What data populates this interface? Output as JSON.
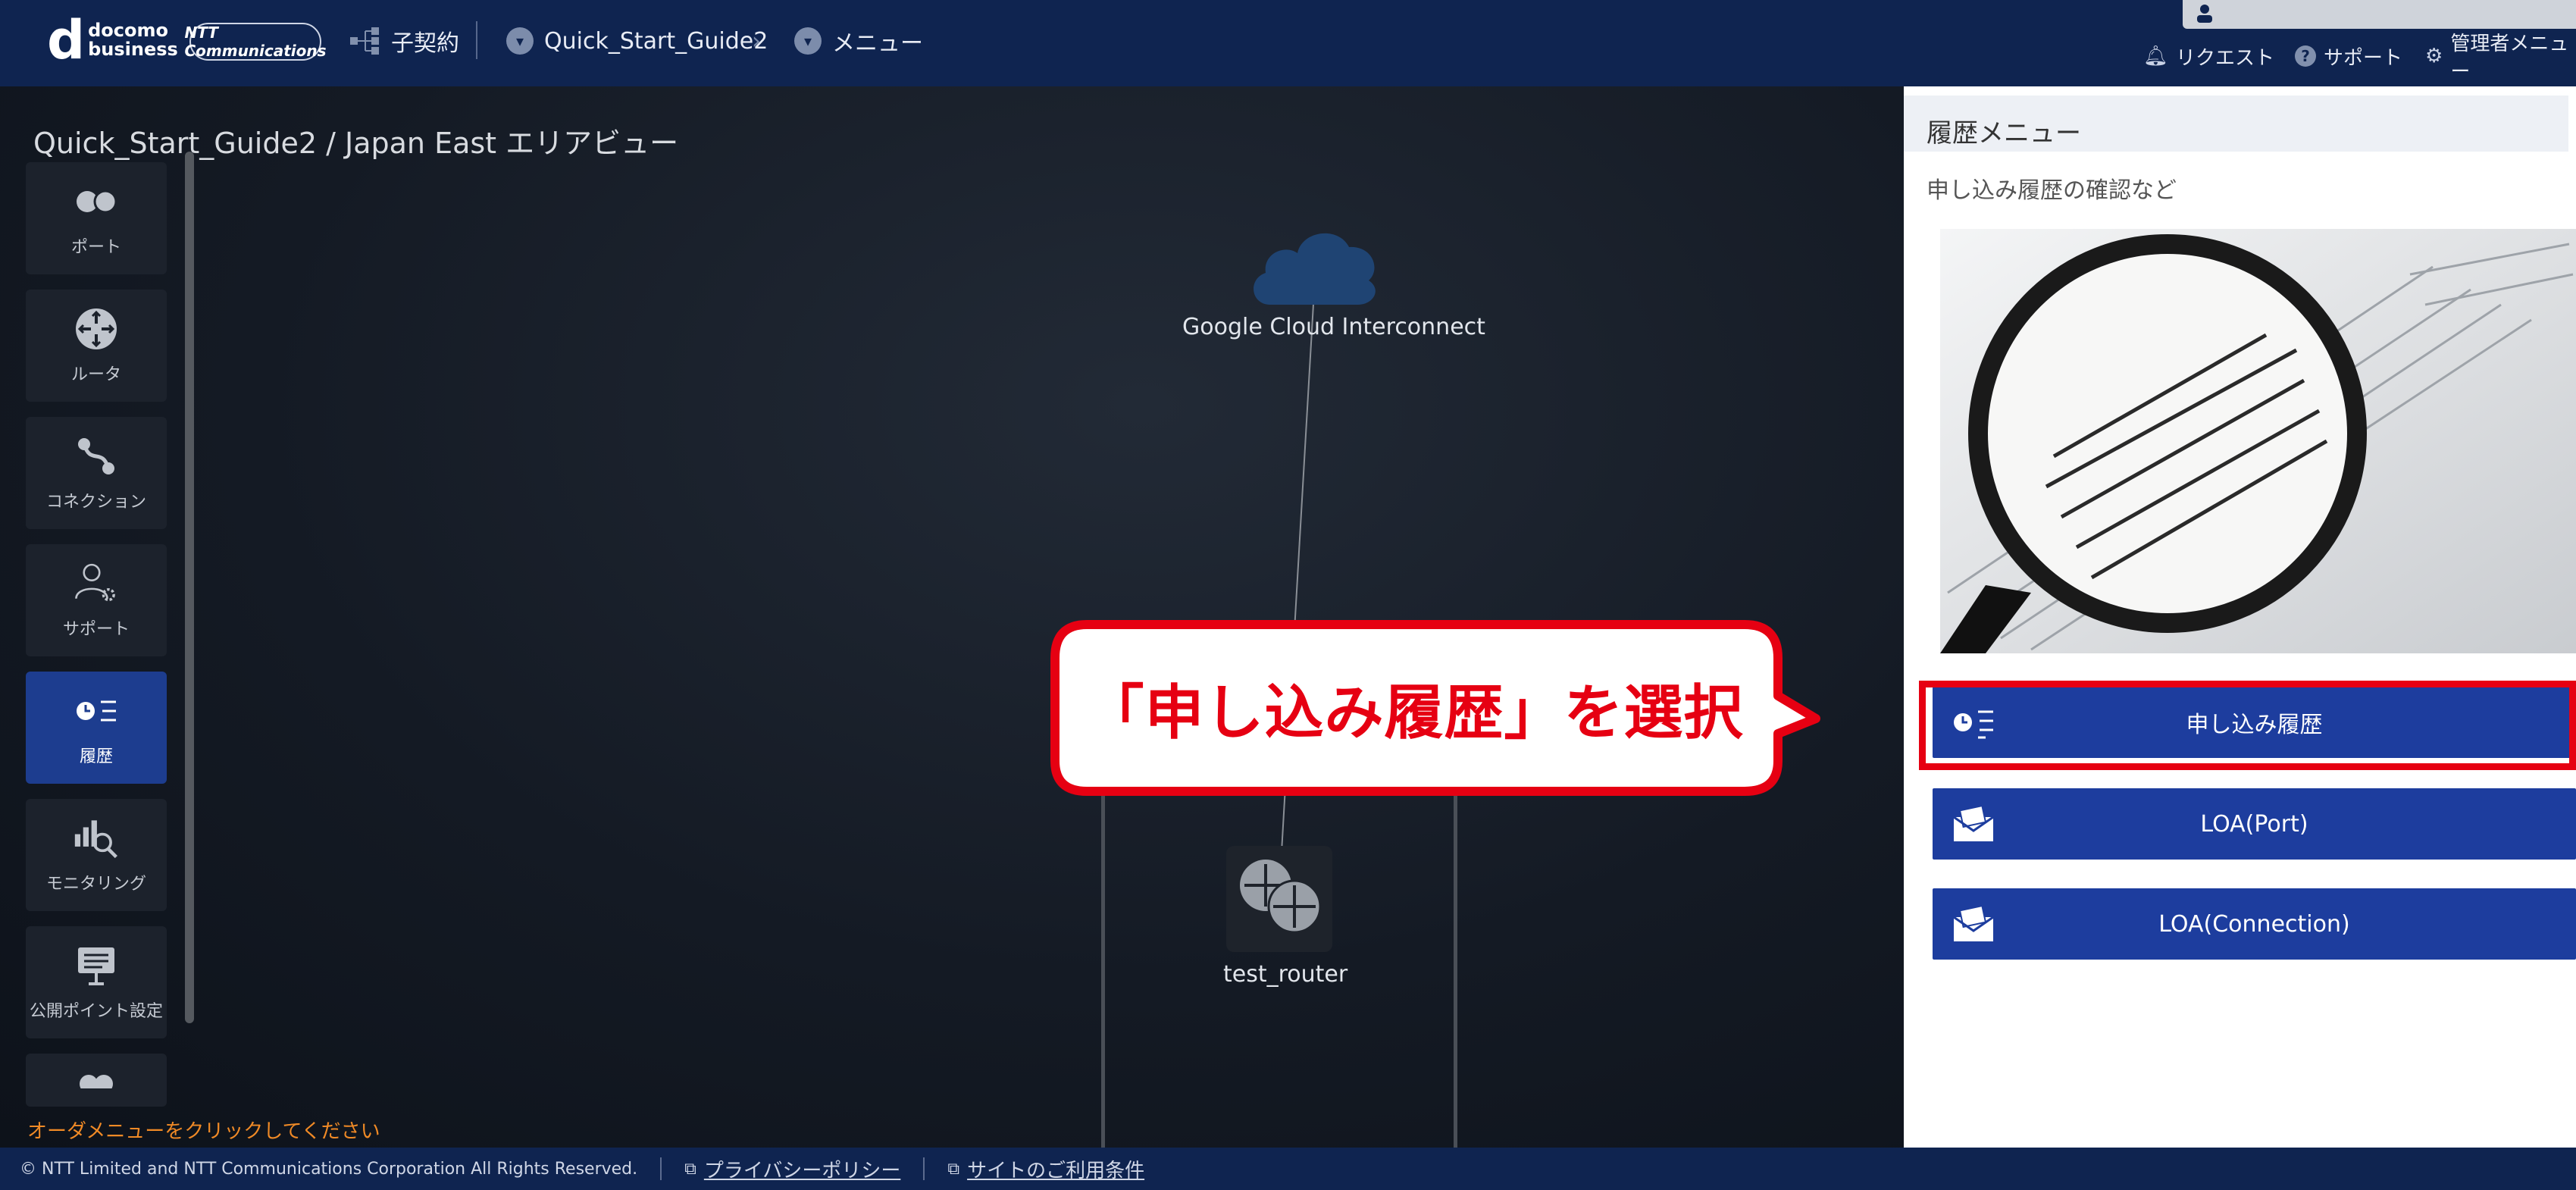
{
  "header": {
    "logo_d": "d",
    "logo_line1": "docomo",
    "logo_line2": "business",
    "ntt_logo": "NTT Communications",
    "nav": [
      {
        "label": "子契約",
        "icon": "hierarchy-icon"
      },
      {
        "label": "Quick_Start_Guide2",
        "icon": "chevron-down-circle-icon"
      },
      {
        "label": "メニュー",
        "icon": "chevron-down-circle-icon"
      }
    ],
    "breadcrumb_sep": "›",
    "right_links": [
      {
        "label": "リクエスト",
        "icon": "bell-icon"
      },
      {
        "label": "サポート",
        "icon": "help-icon"
      },
      {
        "label": "管理者メニュー",
        "icon": "gear-icon"
      }
    ]
  },
  "canvas": {
    "title": "Quick_Start_Guide2 / Japan East エリアビュー",
    "order_message": "オーダメニューをクリックしてください",
    "cloud_label": "Google Cloud Interconnect",
    "router_label": "test_router"
  },
  "sidebar": {
    "items": [
      {
        "label": "ポート",
        "icon": "port-icon",
        "active": false
      },
      {
        "label": "ルータ",
        "icon": "router-icon",
        "active": false
      },
      {
        "label": "コネクション",
        "icon": "connection-icon",
        "active": false
      },
      {
        "label": "サポート",
        "icon": "support-user-icon",
        "active": false
      },
      {
        "label": "履歴",
        "icon": "history-icon",
        "active": true
      },
      {
        "label": "モニタリング",
        "icon": "monitoring-icon",
        "active": false
      },
      {
        "label": "公開ポイント設定",
        "icon": "board-icon",
        "active": false
      }
    ]
  },
  "panel": {
    "title": "履歴メニュー",
    "subtitle": "申し込み履歴の確認など",
    "buttons": [
      {
        "label": "申し込み履歴",
        "icon": "history-list-icon"
      },
      {
        "label": "LOA(Port)",
        "icon": "mail-doc-icon"
      },
      {
        "label": "LOA(Connection)",
        "icon": "mail-doc-icon"
      }
    ]
  },
  "callout": {
    "text": "「申し込み履歴」を選択"
  },
  "footer": {
    "copyright": "© NTT Limited and NTT Communications Corporation All Rights Reserved.",
    "privacy": "プライバシーポリシー",
    "terms": "サイトのご利用条件"
  },
  "colors": {
    "header_bg": "#0f2450",
    "accent_blue": "#1d3d9e",
    "highlight_red": "#e60012",
    "order_orange": "#f08a26"
  }
}
